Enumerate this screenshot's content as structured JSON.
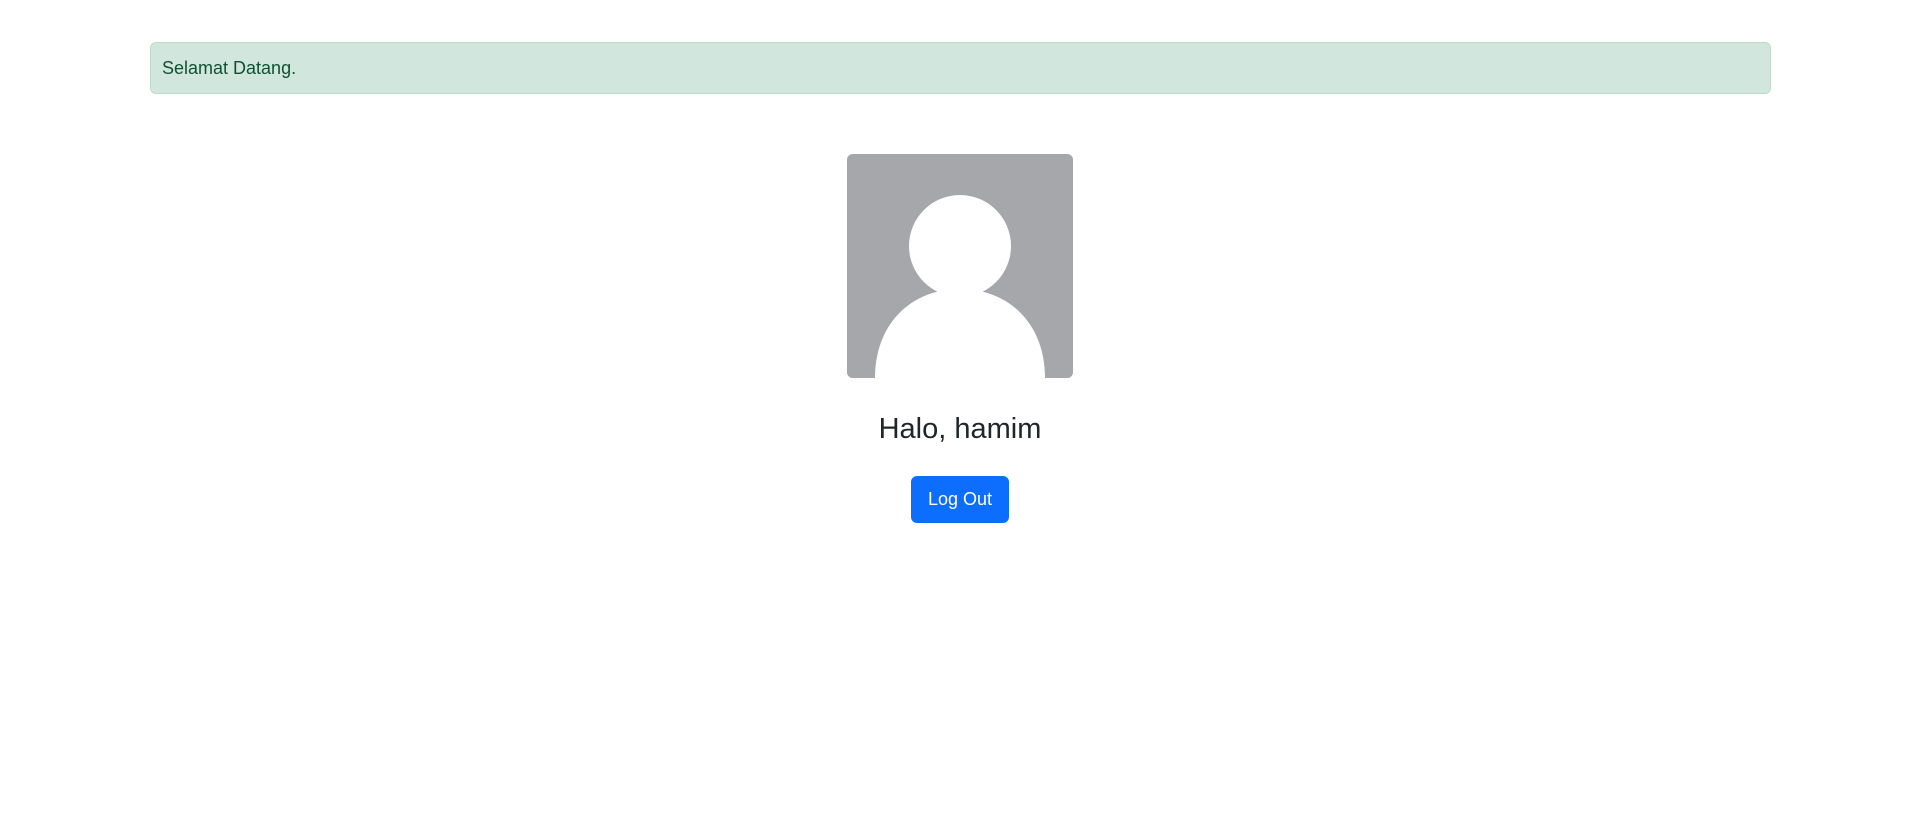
{
  "alert": {
    "message": "Selamat Datang."
  },
  "profile": {
    "avatar_icon": "user-silhouette-icon",
    "greeting": "Halo, hamim",
    "logout_label": "Log Out"
  },
  "colors": {
    "alert_background": "#d1e7dd",
    "alert_border": "#badbcc",
    "alert_text": "#0f5132",
    "avatar_background": "#a6a7aa",
    "button_primary": "#0d6efd",
    "text_dark": "#212529"
  }
}
